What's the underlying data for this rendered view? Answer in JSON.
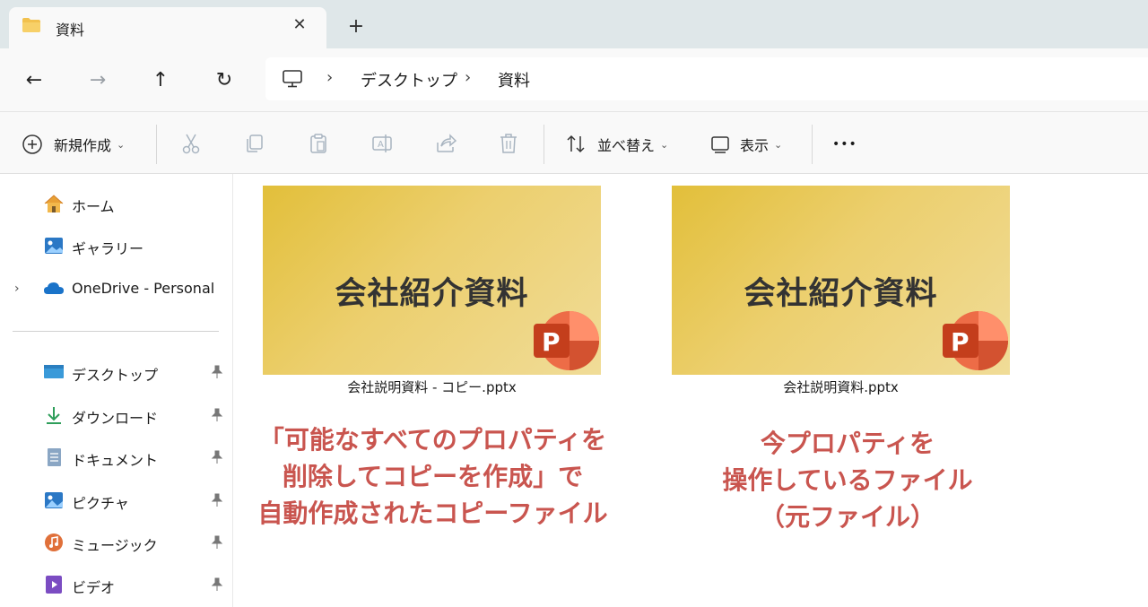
{
  "window": {
    "tab_title": "資料",
    "tab_close_glyph": "✕",
    "new_tab_glyph": "+"
  },
  "nav": {
    "back_glyph": "←",
    "forward_glyph": "→",
    "up_glyph": "↑",
    "refresh_glyph": "↻",
    "breadcrumb": [
      "デスクトップ",
      "資料"
    ],
    "separator": "›"
  },
  "toolbar": {
    "new_label": "新規作成",
    "sort_label": "並べ替え",
    "view_label": "表示",
    "more_glyph": "•••",
    "chevron": "⌄"
  },
  "sidebar": {
    "items": [
      {
        "label": "ホーム",
        "icon": "home-icon"
      },
      {
        "label": "ギャラリー",
        "icon": "gallery-icon"
      },
      {
        "label": "OneDrive - Personal",
        "icon": "onedrive-icon"
      }
    ],
    "quick_access": [
      {
        "label": "デスクトップ",
        "icon": "desktop-icon"
      },
      {
        "label": "ダウンロード",
        "icon": "download-icon"
      },
      {
        "label": "ドキュメント",
        "icon": "documents-icon"
      },
      {
        "label": "ピクチャ",
        "icon": "pictures-icon"
      },
      {
        "label": "ミュージック",
        "icon": "music-icon"
      },
      {
        "label": "ビデオ",
        "icon": "videos-icon"
      }
    ],
    "expander_glyph": "›"
  },
  "files": [
    {
      "name": "会社説明資料 - コピー.pptx",
      "slide_title": "会社紹介資料",
      "badge": "P"
    },
    {
      "name": "会社説明資料.pptx",
      "slide_title": "会社紹介資料",
      "badge": "P"
    }
  ],
  "annotations": {
    "left": [
      "「可能なすべてのプロパティを",
      "削除してコピーを作成」で",
      "自動作成されたコピーファイル"
    ],
    "right": [
      "今プロパティを",
      "操作しているファイル",
      "（元ファイル）"
    ]
  },
  "colors": {
    "accent_annotation": "#c9554f",
    "powerpoint": "#d24726"
  }
}
